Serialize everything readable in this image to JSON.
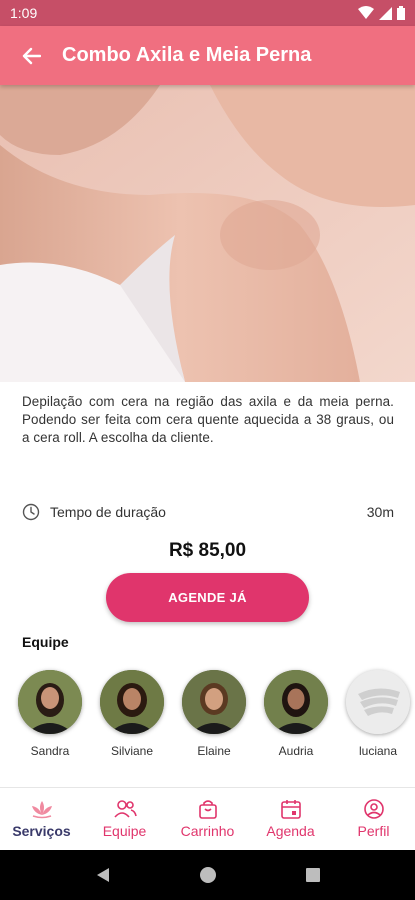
{
  "status_bar": {
    "time": "1:09"
  },
  "app_bar": {
    "title": "Combo Axila e Meia Perna"
  },
  "service": {
    "description": "Depilação com cera na região das axila e da meia perna. Podendo ser feita com cera quente aquecida a 38 graus, ou a cera roll. A escolha da cliente.",
    "duration_label": "Tempo de duração",
    "duration_value": "30m",
    "price": "R$ 85,00",
    "book_label": "AGENDE JÁ"
  },
  "team": {
    "title": "Equipe",
    "members": [
      {
        "name": "Sandra"
      },
      {
        "name": "Silviane"
      },
      {
        "name": "Elaine"
      },
      {
        "name": "Audria"
      },
      {
        "name": "luciana"
      }
    ]
  },
  "bottom_nav": [
    {
      "label": "Serviços",
      "icon": "lotus-icon",
      "active": true
    },
    {
      "label": "Equipe",
      "icon": "people-icon",
      "active": false
    },
    {
      "label": "Carrinho",
      "icon": "shopping-bag-icon",
      "active": false
    },
    {
      "label": "Agenda",
      "icon": "calendar-icon",
      "active": false
    },
    {
      "label": "Perfil",
      "icon": "profile-icon",
      "active": false
    }
  ],
  "colors": {
    "app_bar": "#f06f80",
    "status_bar": "#c64f67",
    "accent": "#e0356c",
    "active_nav_label": "#3a3a6a"
  }
}
